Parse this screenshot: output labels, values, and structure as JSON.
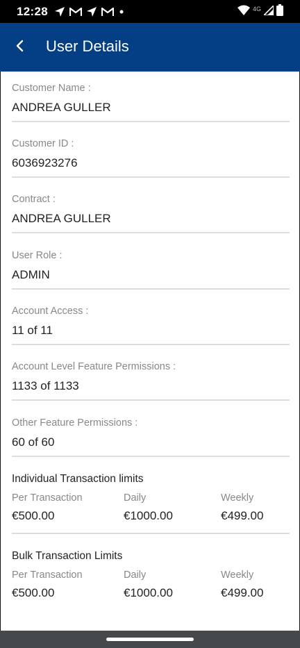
{
  "status_bar": {
    "time": "12:28",
    "network": "4G",
    "left_icons": [
      "navigation-icon",
      "gmail-icon",
      "navigation-icon",
      "gmail-icon",
      "dot-icon"
    ],
    "right_icons": [
      "wifi-icon",
      "signal-icon",
      "battery-icon"
    ]
  },
  "header": {
    "title": "User Details",
    "back_icon": "chevron-left-icon",
    "color": "#043f85"
  },
  "fields": [
    {
      "label": "Customer Name :",
      "value": "ANDREA GULLER"
    },
    {
      "label": "Customer ID :",
      "value": "6036923276"
    },
    {
      "label": "Contract :",
      "value": "ANDREA GULLER"
    },
    {
      "label": "User Role :",
      "value": "ADMIN"
    },
    {
      "label": "Account Access :",
      "value": "11 of 11"
    },
    {
      "label": "Account Level Feature Permissions :",
      "value": "1133 of 1133"
    },
    {
      "label": "Other Feature Permissions :",
      "value": "60 of 60"
    }
  ],
  "individual_limits": {
    "title": "Individual Transaction limits",
    "per_transaction_label": "Per Transaction",
    "per_transaction_value": "€500.00",
    "daily_label": "Daily",
    "daily_value": "€1000.00",
    "weekly_label": "Weekly",
    "weekly_value": "€499.00"
  },
  "bulk_limits": {
    "title": "Bulk Transaction Limits",
    "per_transaction_label": "Per Transaction",
    "per_transaction_value": "€500.00",
    "daily_label": "Daily",
    "daily_value": "€1000.00",
    "weekly_label": "Weekly",
    "weekly_value": "€499.00"
  }
}
